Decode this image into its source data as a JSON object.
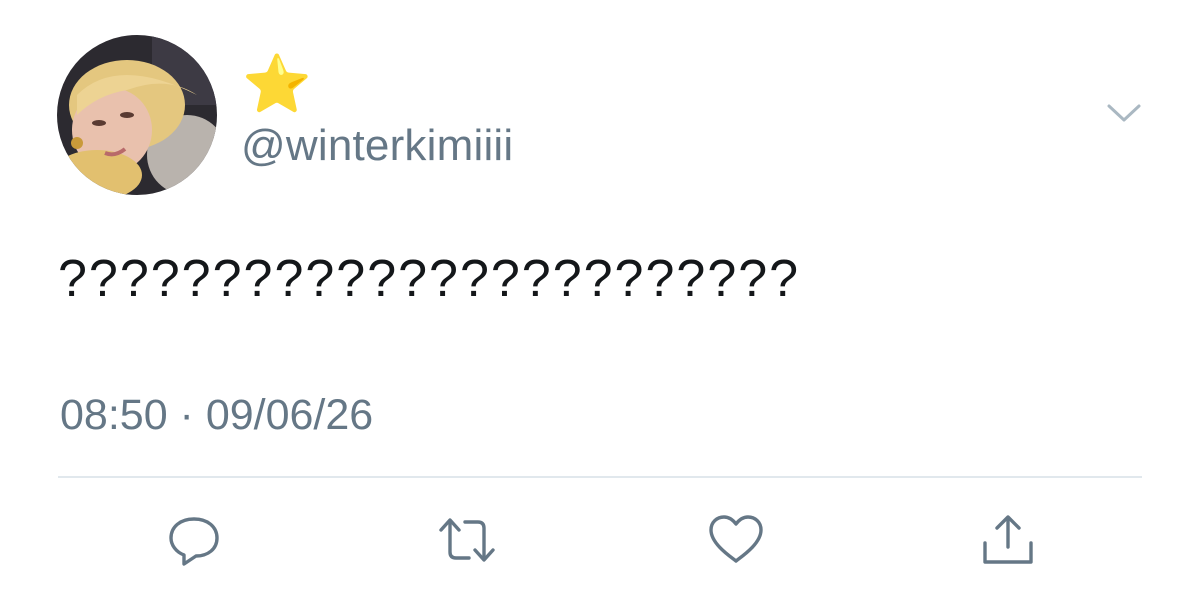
{
  "user": {
    "display_name": "⭐",
    "handle": "@winterkimiiii"
  },
  "tweet": {
    "text": "????????????????????????",
    "timestamp": "08:50 · 09/06/26"
  },
  "icons": {
    "menu": "chevron-down-icon",
    "reply": "reply-icon",
    "retweet": "retweet-icon",
    "like": "heart-icon",
    "share": "share-icon"
  },
  "colors": {
    "icon_gray": "#657786",
    "text": "#14171a",
    "divider": "#e1e8ed",
    "star": "#f7b928"
  }
}
